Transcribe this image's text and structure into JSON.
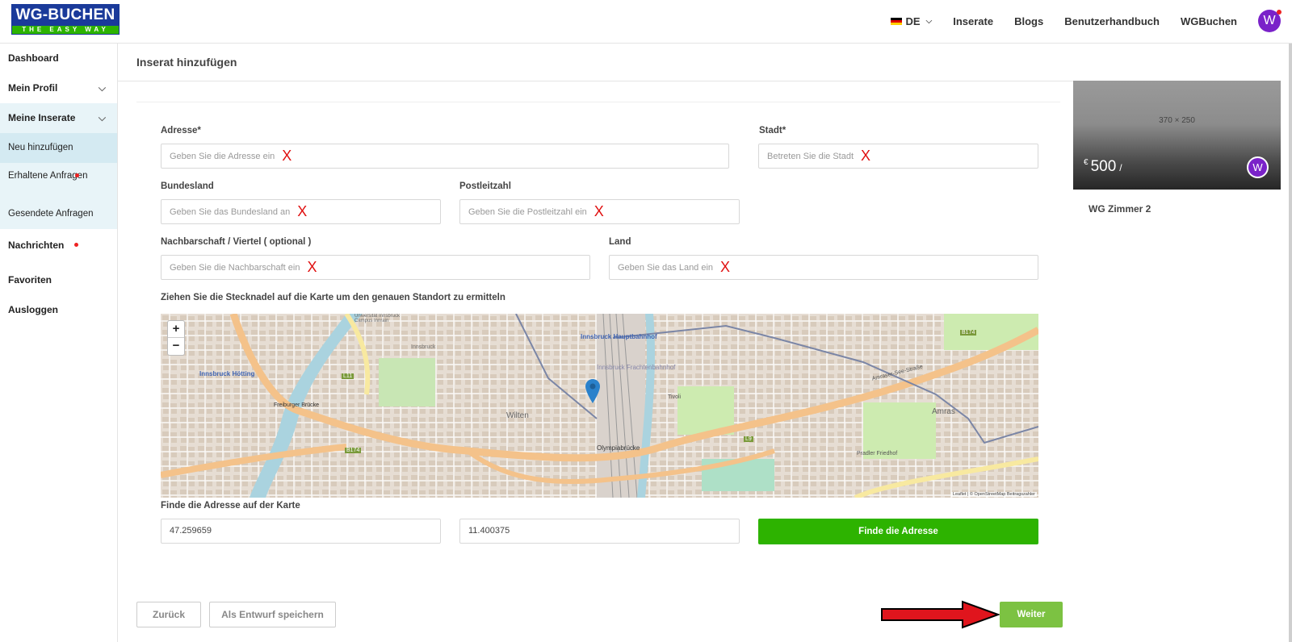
{
  "brand": {
    "line1": "WG-BUCHEN",
    "line2": "THE EASY WAY",
    "blue": "#1a3a9a",
    "green": "#2db300"
  },
  "topnav": {
    "lang": "DE",
    "links": [
      "Inserate",
      "Blogs",
      "Benutzerhandbuch",
      "WGBuchen"
    ],
    "avatar_letter": "W"
  },
  "sidebar": {
    "dashboard": "Dashboard",
    "profile": "Mein Profil",
    "listings": "Meine Inserate",
    "new": "Neu hinzufügen",
    "received": "Erhaltene Anfragen",
    "sent": "Gesendete Anfragen",
    "messages": "Nachrichten",
    "favorites": "Favoriten",
    "logout": "Ausloggen"
  },
  "page": {
    "title": "Inserat hinzufügen"
  },
  "form": {
    "address": {
      "label": "Adresse*",
      "placeholder": "Geben Sie die Adresse ein"
    },
    "city": {
      "label": "Stadt*",
      "placeholder": "Betreten Sie die Stadt"
    },
    "state": {
      "label": "Bundesland",
      "placeholder": "Geben Sie das Bundesland an"
    },
    "zip": {
      "label": "Postleitzahl",
      "placeholder": "Geben Sie die Postleitzahl ein"
    },
    "neighborhood": {
      "label": "Nachbarschaft / Viertel ( optional )",
      "placeholder": "Geben Sie die Nachbarschaft ein"
    },
    "country": {
      "label": "Land",
      "placeholder": "Geben Sie das Land ein"
    },
    "marker": "X",
    "map_hint": "Ziehen Sie die Stecknadel auf die Karte um den genauen Standort zu ermitteln",
    "find_label": "Finde die Adresse auf der Karte",
    "lat": "47.259659",
    "lng": "11.400375",
    "find_button": "Finde die Adresse"
  },
  "map": {
    "zoom_in": "+",
    "zoom_out": "−",
    "places": [
      "Innsbruck Hötting",
      "Innsbruck Hauptbahnhof",
      "Innsbruck Frachtenbahnhof",
      "Wilten",
      "Amras",
      "Freiburger Brücke",
      "Olympiabrücke",
      "Tivoli",
      "Pradler Friedhof",
      "Amraser-See-Straße",
      "Universität Innsbruck Campus Innrain",
      "Innsbruck"
    ],
    "roads": [
      "L11",
      "B174",
      "B174",
      "L9"
    ],
    "attribution": "Leaflet | © OpenStreetMap Beitragszahler"
  },
  "footer_buttons": {
    "back": "Zurück",
    "draft": "Als Entwurf speichern",
    "next": "Weiter"
  },
  "card": {
    "dims": "370 × 250",
    "currency": "€",
    "price": "500",
    "per": "/",
    "avatar_letter": "W",
    "title": "WG Zimmer 2"
  }
}
